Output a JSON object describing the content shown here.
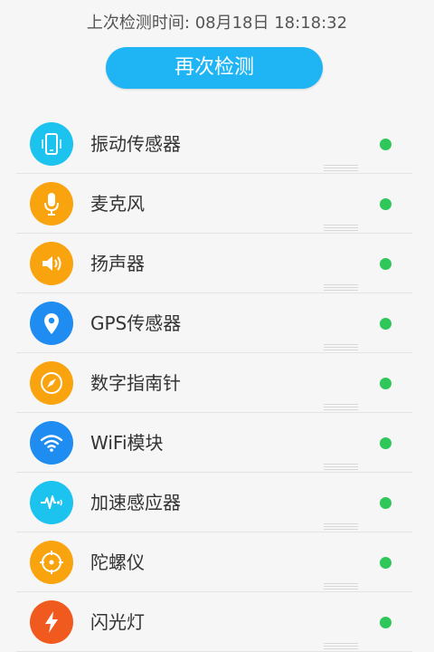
{
  "header": {
    "last_check": "上次检测时间: 08月18日 18:18:32"
  },
  "actions": {
    "recheck_label": "再次检测"
  },
  "colors": {
    "accent": "#1fb5f5",
    "status_ok": "#2fc65a",
    "cyan": "#1cc3ef",
    "orange": "#f9a30f",
    "blue": "#1e8cf0",
    "flash": "#f05a1e"
  },
  "sensors": [
    {
      "label": "振动传感器",
      "icon": "phone-vibration-icon",
      "color": "#1cc3ef",
      "status": "ok"
    },
    {
      "label": "麦克风",
      "icon": "microphone-icon",
      "color": "#f9a30f",
      "status": "ok"
    },
    {
      "label": "扬声器",
      "icon": "speaker-icon",
      "color": "#f9a30f",
      "status": "ok"
    },
    {
      "label": "GPS传感器",
      "icon": "location-pin-icon",
      "color": "#1e8cf0",
      "status": "ok"
    },
    {
      "label": "数字指南针",
      "icon": "compass-icon",
      "color": "#f9a30f",
      "status": "ok"
    },
    {
      "label": "WiFi模块",
      "icon": "wifi-icon",
      "color": "#1e8cf0",
      "status": "ok"
    },
    {
      "label": "加速感应器",
      "icon": "pulse-icon",
      "color": "#1cc3ef",
      "status": "ok"
    },
    {
      "label": "陀螺仪",
      "icon": "gyroscope-icon",
      "color": "#f9a30f",
      "status": "ok"
    },
    {
      "label": "闪光灯",
      "icon": "flash-icon",
      "color": "#f05a1e",
      "status": "ok"
    }
  ]
}
